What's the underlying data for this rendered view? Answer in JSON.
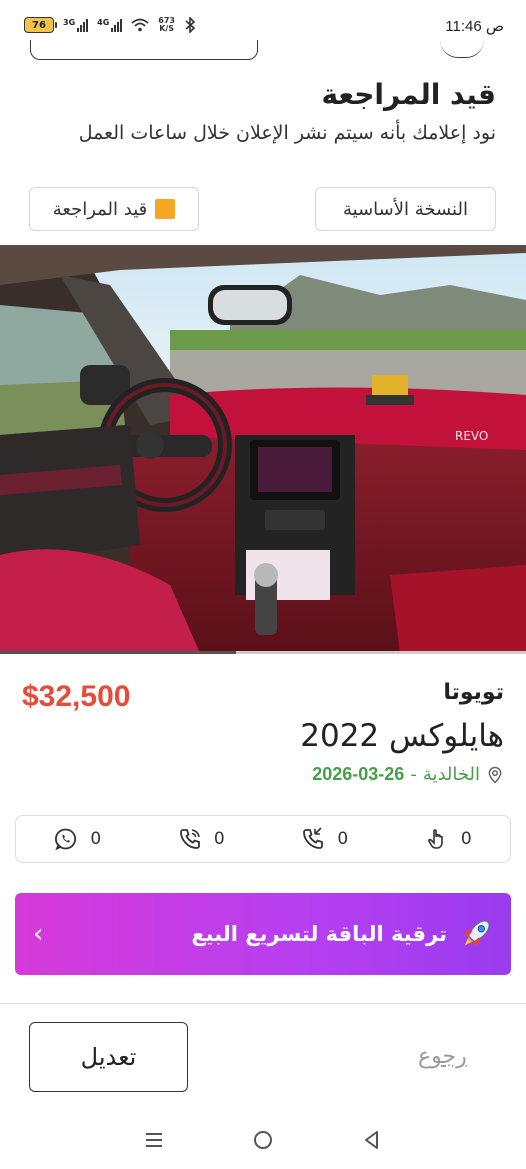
{
  "status_bar": {
    "battery": "76",
    "network_1": "3G",
    "network_2": "4G",
    "speed_value": "673",
    "speed_unit": "K/S",
    "time": "11:46",
    "ampm": "ص"
  },
  "review": {
    "title": "قيد المراجعة",
    "description": "نود إعلامك بأنه سيتم نشر الإعلان خلال ساعات العمل",
    "basic_version_label": "النسخة الأساسية",
    "status_label": "قيد المراجعة",
    "status_color": "#f5a623"
  },
  "listing": {
    "price": "$32,500",
    "brand": "تويوتا",
    "model": "هايلوكس 2022",
    "location": "الخالدية",
    "separator": "-",
    "date": "2026-03-26",
    "photo_index": 1,
    "photo_count": 2
  },
  "stats": [
    {
      "icon": "touch-icon",
      "value": "0"
    },
    {
      "icon": "phone-call-icon",
      "value": "0"
    },
    {
      "icon": "phone-ring-icon",
      "value": "0"
    },
    {
      "icon": "whatsapp-icon",
      "value": "0"
    }
  ],
  "upgrade": {
    "label": "ترقية الباقة لتسريع البيع",
    "icon": "rocket-icon"
  },
  "footer": {
    "edit_label": "تعديل",
    "back_label": "رجوع"
  },
  "colors": {
    "price": "#e44d3a",
    "location_green": "#43a047",
    "upgrade_gradient_start": "#d63ad9",
    "upgrade_gradient_end": "#9b3bef"
  }
}
